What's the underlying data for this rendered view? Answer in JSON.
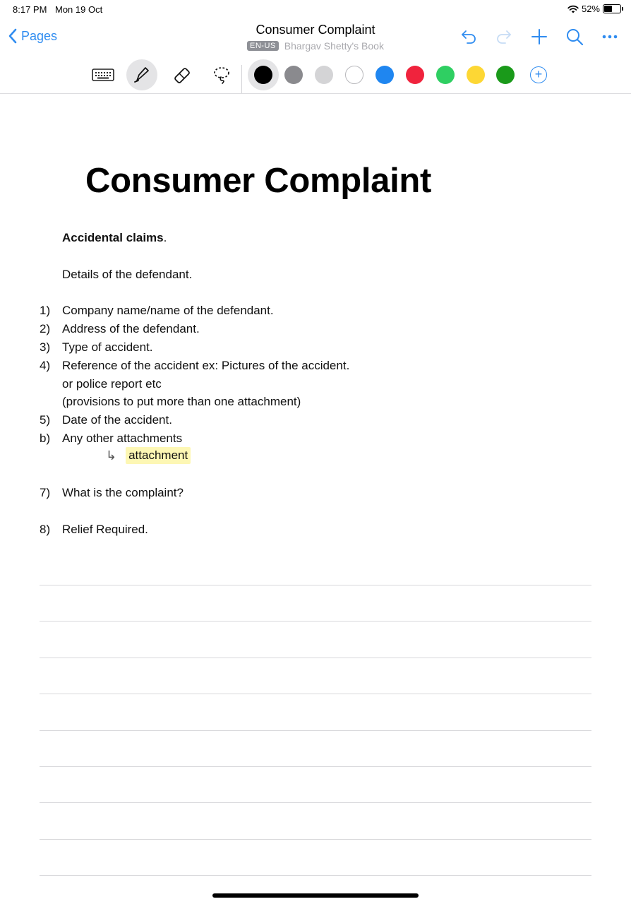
{
  "status_bar": {
    "time": "8:17 PM",
    "date": "Mon 19 Oct",
    "battery": "52%",
    "battery_level": 0.52
  },
  "nav": {
    "back_label": "Pages",
    "title": "Consumer Complaint",
    "lang": "EN-US",
    "book": "Bhargav Shetty's Book",
    "icons": [
      "undo-icon",
      "redo-icon",
      "plus-icon",
      "search-icon",
      "more-icon"
    ]
  },
  "toolbar": {
    "tools": [
      "keyboard-icon",
      "pen-icon",
      "eraser-icon",
      "lasso-icon"
    ],
    "active_tool": "pen",
    "colors": [
      "#000000",
      "#8a8a8e",
      "#d4d4d6",
      "#ffffff",
      "#1f86f0",
      "#f0233d",
      "#2fcf62",
      "#fdd734",
      "#1a9a1a"
    ],
    "selected_color": "#000000",
    "accent": "#2f8cf0"
  },
  "document": {
    "heading": "Consumer Complaint",
    "claims_bold": "Accidental claims",
    "claims_dot": ".",
    "details": "Details of the defendant.",
    "items": [
      {
        "num": "1)",
        "text": "Company name/name of the defendant."
      },
      {
        "num": "2)",
        "text": "Address of the defendant."
      },
      {
        "num": "3)",
        "text": "Type of accident."
      },
      {
        "num": "4)",
        "text": "Reference of the accident ex: Pictures of the accident."
      },
      {
        "num": "",
        "text": "or police report etc"
      },
      {
        "num": "",
        "text": "(provisions to put more than one attachment)"
      },
      {
        "num": "5)",
        "text": "Date of the accident."
      },
      {
        "num": "b)",
        "text": "Any other attachments"
      }
    ],
    "attachment_label": "attachment",
    "item7_num": "7)",
    "item7_text": "What is the complaint?",
    "item8_num": "8)",
    "item8_text": "Relief Required."
  }
}
